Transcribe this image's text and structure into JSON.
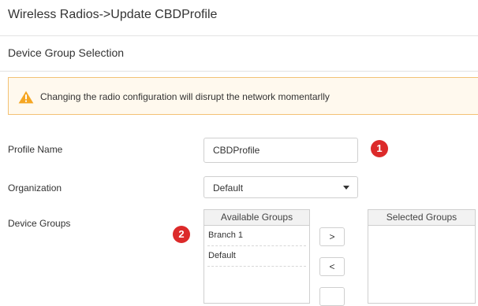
{
  "header": {
    "title": "Wireless Radios->Update CBDProfile"
  },
  "section": {
    "title": "Device Group Selection"
  },
  "warning": {
    "icon": "warning-icon",
    "icon_color": "#f5a623",
    "message": "Changing the radio configuration will disrupt the network momentarlly"
  },
  "form": {
    "profile_name": {
      "label": "Profile Name",
      "value": "CBDProfile"
    },
    "organization": {
      "label": "Organization",
      "selected": "Default"
    },
    "device_groups": {
      "label": "Device Groups",
      "available": {
        "header": "Available Groups",
        "items": [
          "Branch 1",
          "Default"
        ]
      },
      "selected": {
        "header": "Selected Groups",
        "items": []
      },
      "add_label": ">",
      "remove_label": "<"
    }
  },
  "markers": {
    "color": "#dc2a2a",
    "first": "1",
    "second": "2"
  }
}
